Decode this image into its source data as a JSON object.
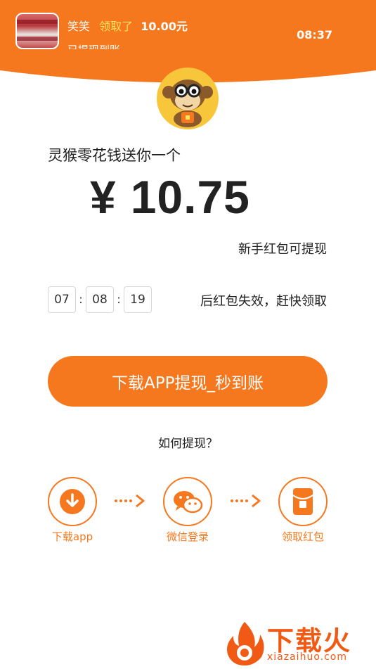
{
  "colors": {
    "accent": "#f5781e",
    "highlight": "#ffe35a",
    "text": "#222222",
    "border": "#d7d7d7"
  },
  "header": {
    "user_name": "笑笑",
    "claimed_text": "领取了",
    "amount_text": "10.00元",
    "second_line": "已提现到账",
    "time": "08:37"
  },
  "logo": {
    "icon": "monkey-logo-icon"
  },
  "main": {
    "subtitle": "灵猴零花钱送你一个",
    "currency_symbol": "¥",
    "amount": "10.75",
    "note": "新手红包可提现",
    "countdown": {
      "hours": "07",
      "minutes": "08",
      "seconds": "19",
      "separator": ":"
    },
    "countdown_text": "后红包失效，赶快领取",
    "cta_label": "下载APP提现_秒到账",
    "howto_label": "如何提现？"
  },
  "steps": [
    {
      "icon": "download-icon",
      "label": "下载app"
    },
    {
      "icon": "wechat-icon",
      "label": "微信登录"
    },
    {
      "icon": "red-packet-icon",
      "label": "领取红包"
    }
  ],
  "watermark": {
    "brand": "下载火",
    "url": "xiazaihuo.com"
  }
}
